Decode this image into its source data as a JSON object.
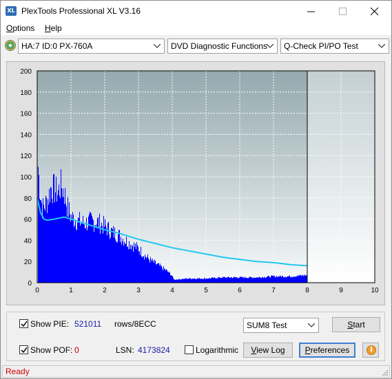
{
  "window": {
    "title": "PlexTools Professional XL V3.16",
    "icon_text": "XL"
  },
  "menu": {
    "options": {
      "label": "ptions",
      "accel": "O"
    },
    "help": {
      "label": "elp",
      "accel": "H"
    }
  },
  "toolbar": {
    "drive": "HA:7 ID:0  PX-760A",
    "function": "DVD Diagnostic Functions",
    "test": "Q-Check PI/PO Test"
  },
  "chart_data": {
    "type": "area",
    "xlim": [
      0,
      10
    ],
    "ylim": [
      0,
      200
    ],
    "x_ticks": [
      "0",
      "1",
      "2",
      "3",
      "4",
      "5",
      "6",
      "7",
      "8",
      "9",
      "10"
    ],
    "y_ticks": [
      "0",
      "20",
      "40",
      "60",
      "80",
      "100",
      "120",
      "140",
      "160",
      "180",
      "200"
    ],
    "data_end_x": 8.0,
    "colors": {
      "pie_bars": "#0000ff",
      "trend_line": "#22c8f0",
      "plot_bg_top": "#98acb2",
      "plot_bg_bottom": "#f4f8f8"
    },
    "series": [
      {
        "kind": "bars",
        "x": [
          0.0,
          0.05,
          0.1,
          0.15,
          0.2,
          0.3,
          0.4,
          0.5,
          0.6,
          0.7,
          0.8,
          0.9,
          1.0,
          1.2,
          1.4,
          1.6,
          1.8,
          2.0,
          2.2,
          2.4,
          2.6,
          2.8,
          3.0,
          3.2,
          3.4,
          3.6,
          3.8,
          3.95,
          4.05,
          4.5,
          5.0,
          5.5,
          6.0,
          6.5,
          7.0,
          7.5,
          7.9
        ],
        "y": [
          120,
          95,
          80,
          70,
          72,
          78,
          90,
          88,
          85,
          92,
          84,
          70,
          62,
          58,
          56,
          58,
          57,
          53,
          48,
          45,
          40,
          36,
          32,
          25,
          20,
          16,
          12,
          8,
          3,
          4,
          4,
          5,
          5,
          5,
          6,
          6,
          7
        ]
      },
      {
        "kind": "line",
        "x": [
          0.0,
          0.1,
          0.2,
          0.3,
          0.5,
          0.8,
          1.0,
          1.5,
          2.0,
          2.5,
          3.0,
          3.5,
          4.0,
          4.5,
          5.0,
          5.5,
          6.0,
          6.5,
          7.0,
          7.5,
          8.0
        ],
        "y": [
          80,
          66,
          60,
          59,
          60,
          62,
          60,
          55,
          50,
          46,
          41,
          37,
          33,
          30,
          27,
          24,
          22,
          20,
          19,
          17,
          16
        ]
      }
    ]
  },
  "panel": {
    "show_pie_label": "Show PIE:",
    "pie_value": "521011",
    "pie_unit": "rows/8ECC",
    "show_pof_label": "Show POF:",
    "pof_value": "0",
    "lsn_label": "LSN:",
    "lsn_value": "4173824",
    "logarithmic_label": "Logarithmic",
    "sum_select": "SUM8 Test",
    "start_button": {
      "label": "tart",
      "accel": "S"
    },
    "viewlog_button": {
      "label": "iew Log",
      "accel": "V"
    },
    "preferences_button": {
      "label": "references",
      "accel": "P"
    },
    "show_pie_checked": true,
    "show_pof_checked": true,
    "logarithmic_checked": false
  },
  "status": {
    "text": "Ready"
  }
}
